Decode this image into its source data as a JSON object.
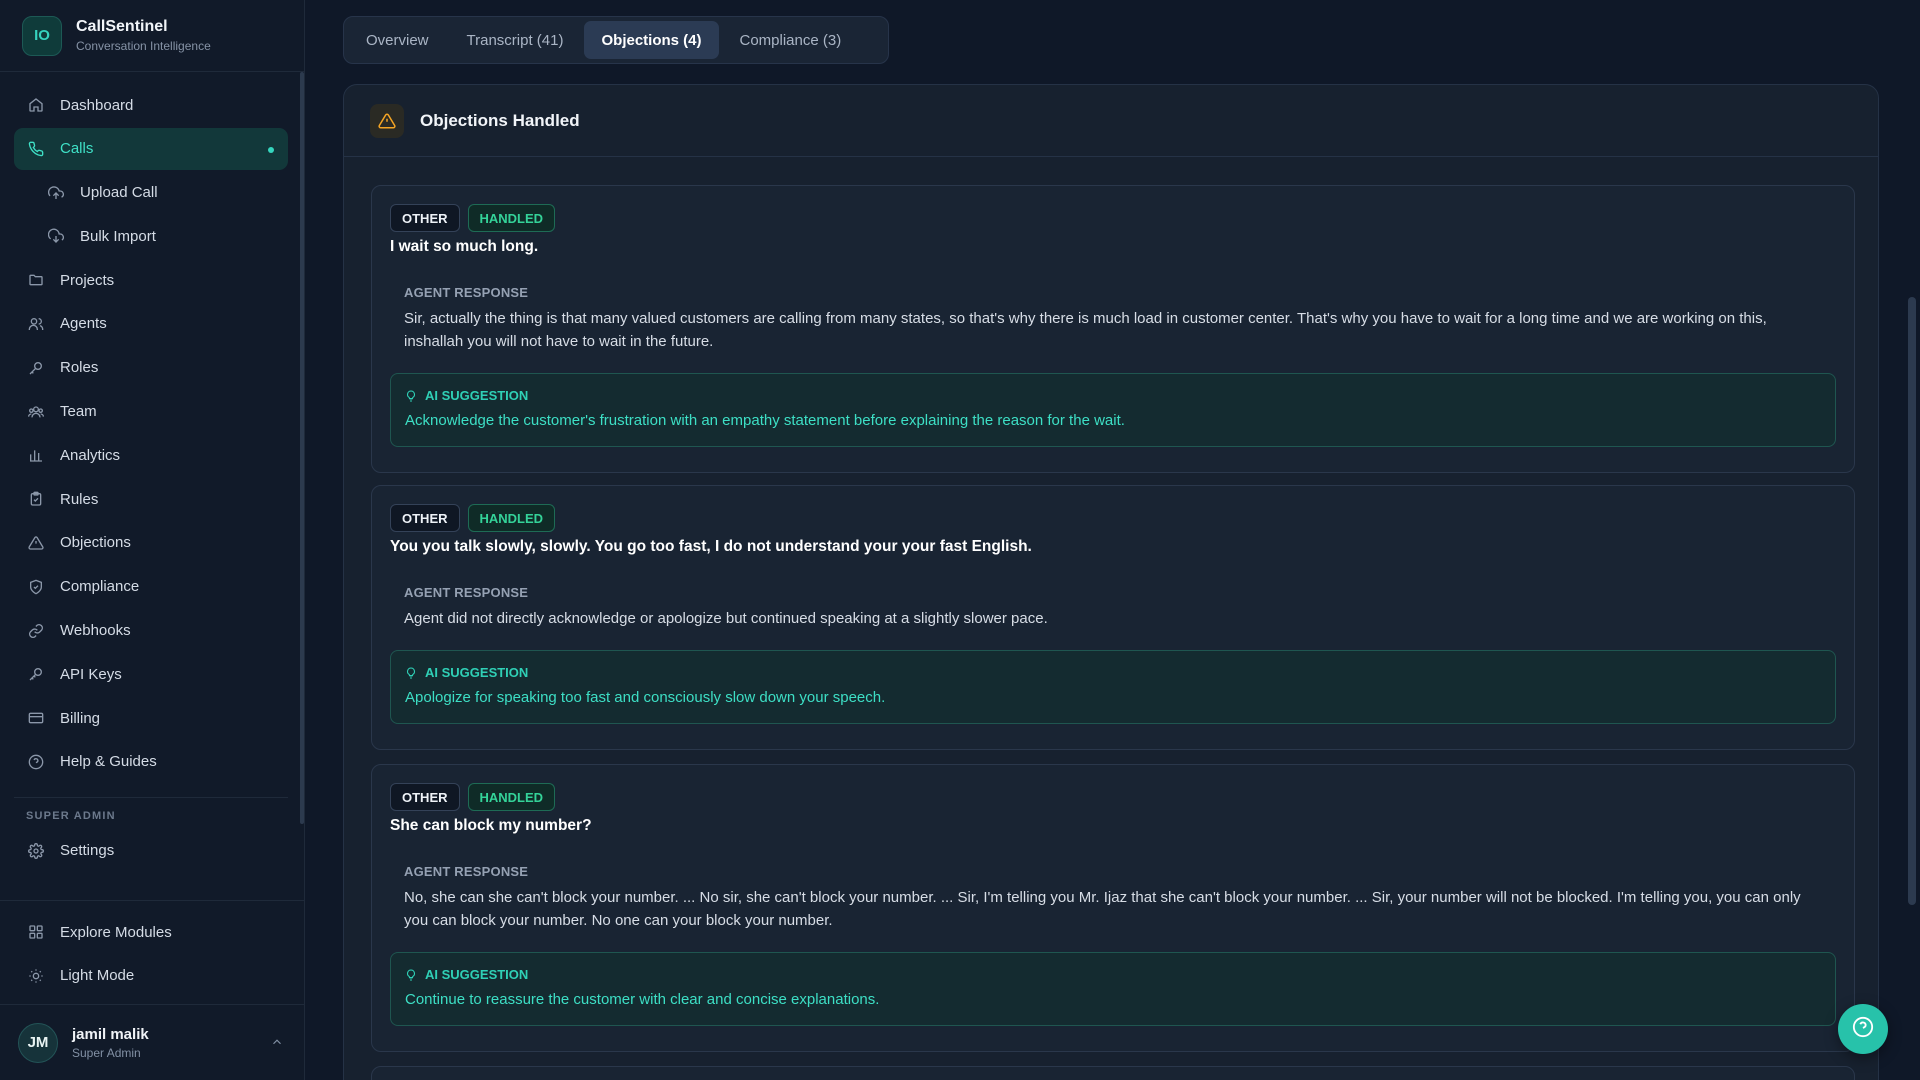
{
  "brand": {
    "logo": "IO",
    "name": "CallSentinel",
    "subtitle": "Conversation Intelligence"
  },
  "sidebar": {
    "items": [
      {
        "label": "Dashboard",
        "icon": "home-icon"
      },
      {
        "label": "Calls",
        "icon": "phone-icon",
        "active": true
      },
      {
        "label": "Upload Call",
        "icon": "upload-cloud-icon",
        "sub": true
      },
      {
        "label": "Bulk Import",
        "icon": "download-cloud-icon",
        "sub": true
      },
      {
        "label": "Projects",
        "icon": "folder-icon"
      },
      {
        "label": "Agents",
        "icon": "users-icon"
      },
      {
        "label": "Roles",
        "icon": "key-icon"
      },
      {
        "label": "Team",
        "icon": "team-icon"
      },
      {
        "label": "Analytics",
        "icon": "bar-chart-icon"
      },
      {
        "label": "Rules",
        "icon": "clipboard-icon"
      },
      {
        "label": "Objections",
        "icon": "warning-icon"
      },
      {
        "label": "Compliance",
        "icon": "shield-icon"
      },
      {
        "label": "Webhooks",
        "icon": "link-icon"
      },
      {
        "label": "API Keys",
        "icon": "api-key-icon"
      },
      {
        "label": "Billing",
        "icon": "credit-card-icon"
      },
      {
        "label": "Help & Guides",
        "icon": "help-circle-icon"
      }
    ],
    "section_label": "SUPER ADMIN",
    "settings_label": "Settings",
    "bottom": [
      {
        "label": "Explore Modules",
        "icon": "grid-icon"
      },
      {
        "label": "Light Mode",
        "icon": "sun-icon"
      }
    ]
  },
  "user": {
    "initials": "JM",
    "name": "jamil malik",
    "role": "Super Admin"
  },
  "tabs": [
    {
      "label": "Overview"
    },
    {
      "label": "Transcript (41)"
    },
    {
      "label": "Objections (4)",
      "active": true
    },
    {
      "label": "Compliance (3)"
    }
  ],
  "panel": {
    "title": "Objections Handled"
  },
  "objections": [
    {
      "type": "OTHER",
      "status": "HANDLED",
      "text": "I wait so much long.",
      "response_label": "AGENT RESPONSE",
      "response": "Sir, actually the thing is that many valued customers are calling from many states, so that's why there is much load in customer center. That's why you have to wait for a long time and we are working on this, inshallah you will not have to wait in the future.",
      "suggestion_label": "AI SUGGESTION",
      "suggestion": "Acknowledge the customer's frustration with an empathy statement before explaining the reason for the wait."
    },
    {
      "type": "OTHER",
      "status": "HANDLED",
      "text": "You you talk slowly, slowly. You go too fast, I do not understand your your fast English.",
      "response_label": "AGENT RESPONSE",
      "response": "Agent did not directly acknowledge or apologize but continued speaking at a slightly slower pace.",
      "suggestion_label": "AI SUGGESTION",
      "suggestion": "Apologize for speaking too fast and consciously slow down your speech."
    },
    {
      "type": "OTHER",
      "status": "HANDLED",
      "text": "She can block my number?",
      "response_label": "AGENT RESPONSE",
      "response": "No, she can she can't block your number. ... No sir, she can't block your number. ... Sir, I'm telling you Mr. Ijaz that she can't block your number. ... Sir, your number will not be blocked. I'm telling you, you can only you can block your number. No one can your block your number.",
      "suggestion_label": "AI SUGGESTION",
      "suggestion": "Continue to reassure the customer with clear and concise explanations."
    }
  ],
  "colors": {
    "accent": "#2fd0b6",
    "background": "#0f1828",
    "handled": "#34d399",
    "warning": "#f5a524"
  }
}
